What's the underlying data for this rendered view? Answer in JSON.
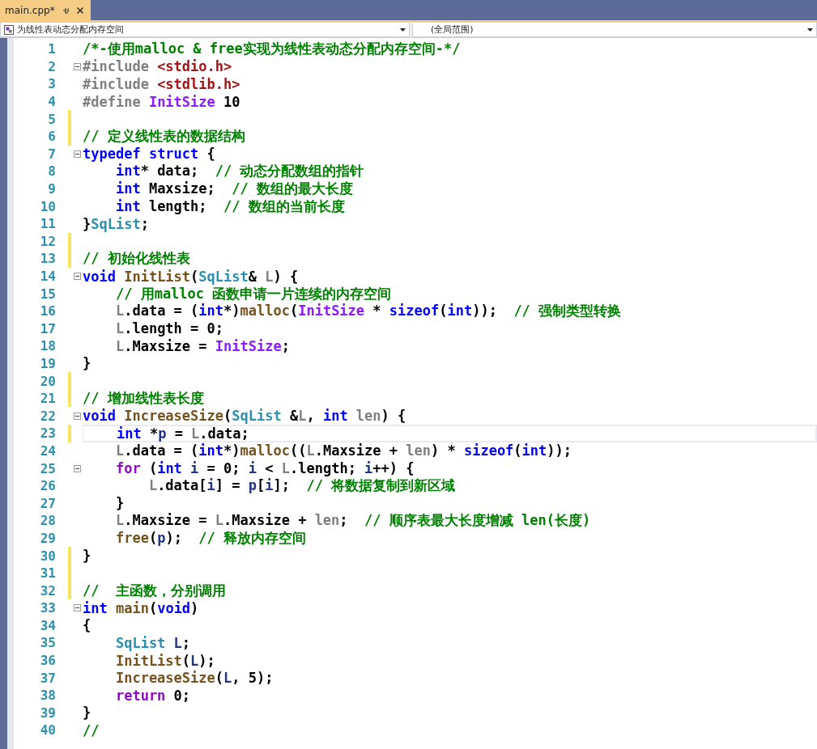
{
  "tabs": [
    {
      "label": "main.cpp*",
      "selected": true
    }
  ],
  "navigation": {
    "scope": "为线性表动态分配内存空间",
    "member": "(全局范围)"
  },
  "lines": [
    {
      "number": "1",
      "changed": false,
      "fold": false,
      "current": false,
      "tokens": [
        {
          "kind": "cm",
          "text": "/*-使用malloc & free实现为线性表动态分配内存空间-*/"
        }
      ]
    },
    {
      "number": "2",
      "changed": false,
      "fold": true,
      "current": false,
      "tokens": [
        {
          "kind": "pre",
          "text": "#include "
        },
        {
          "kind": "str",
          "text": "<stdio.h>"
        }
      ]
    },
    {
      "number": "3",
      "changed": false,
      "fold": false,
      "current": false,
      "tokens": [
        {
          "kind": "pre",
          "text": "#include "
        },
        {
          "kind": "str",
          "text": "<stdlib.h>"
        }
      ]
    },
    {
      "number": "4",
      "changed": false,
      "fold": false,
      "current": false,
      "tokens": [
        {
          "kind": "pre",
          "text": "#define "
        },
        {
          "kind": "mac",
          "text": "InitSize"
        },
        {
          "kind": "pl",
          "text": " 10"
        }
      ]
    },
    {
      "number": "5",
      "changed": true,
      "fold": false,
      "current": false
    },
    {
      "number": "6",
      "changed": true,
      "fold": false,
      "current": false,
      "tokens": [
        {
          "kind": "cm",
          "text": "// 定义线性表的数据结构"
        }
      ]
    },
    {
      "number": "7",
      "changed": false,
      "fold": true,
      "current": false,
      "tokens": [
        {
          "kind": "kw",
          "text": "typedef"
        },
        {
          "kind": "kw",
          "text": " struct"
        },
        {
          "kind": "pl",
          "text": " {"
        }
      ]
    },
    {
      "number": "8",
      "changed": false,
      "fold": false,
      "current": false,
      "tokens": [
        {
          "kind": "kw",
          "text": "    int"
        },
        {
          "kind": "pl",
          "text": "* data;  "
        },
        {
          "kind": "cm",
          "text": "// 动态分配数组的指针"
        }
      ]
    },
    {
      "number": "9",
      "changed": false,
      "fold": false,
      "current": false,
      "tokens": [
        {
          "kind": "kw",
          "text": "    int"
        },
        {
          "kind": "pl",
          "text": " Maxsize;  "
        },
        {
          "kind": "cm",
          "text": "// 数组的最大长度"
        }
      ]
    },
    {
      "number": "10",
      "changed": false,
      "fold": false,
      "current": false,
      "tokens": [
        {
          "kind": "kw",
          "text": "    int"
        },
        {
          "kind": "pl",
          "text": " length;  "
        },
        {
          "kind": "cm",
          "text": "// 数组的当前长度"
        }
      ]
    },
    {
      "number": "11",
      "changed": false,
      "fold": false,
      "current": false,
      "tokens": [
        {
          "kind": "pl",
          "text": "}"
        },
        {
          "kind": "typ",
          "text": "SqList"
        },
        {
          "kind": "pl",
          "text": ";"
        }
      ]
    },
    {
      "number": "12",
      "changed": true,
      "fold": false,
      "current": false
    },
    {
      "number": "13",
      "changed": true,
      "fold": false,
      "current": false,
      "tokens": [
        {
          "kind": "cm",
          "text": "// 初始化线性表"
        }
      ]
    },
    {
      "number": "14",
      "changed": false,
      "fold": true,
      "current": false,
      "tokens": [
        {
          "kind": "kw",
          "text": "void"
        },
        {
          "kind": "fn",
          "text": " InitList"
        },
        {
          "kind": "pl",
          "text": "("
        },
        {
          "kind": "typ",
          "text": "SqList"
        },
        {
          "kind": "pl",
          "text": "& "
        },
        {
          "kind": "prm",
          "text": "L"
        },
        {
          "kind": "pl",
          "text": ") {"
        }
      ]
    },
    {
      "number": "15",
      "changed": false,
      "fold": false,
      "current": false,
      "tokens": [
        {
          "kind": "cm",
          "text": "    // 用malloc 函数申请一片连续的内存空间"
        }
      ]
    },
    {
      "number": "16",
      "changed": false,
      "fold": false,
      "current": false,
      "tokens": [
        {
          "kind": "prm",
          "text": "    L"
        },
        {
          "kind": "pl",
          "text": ".data = ("
        },
        {
          "kind": "kw",
          "text": "int"
        },
        {
          "kind": "pl",
          "text": "*)"
        },
        {
          "kind": "fn",
          "text": "malloc"
        },
        {
          "kind": "pl",
          "text": "("
        },
        {
          "kind": "mac",
          "text": "InitSize"
        },
        {
          "kind": "pl",
          "text": " * "
        },
        {
          "kind": "kw",
          "text": "sizeof"
        },
        {
          "kind": "pl",
          "text": "("
        },
        {
          "kind": "kw",
          "text": "int"
        },
        {
          "kind": "pl",
          "text": "));  "
        },
        {
          "kind": "cm",
          "text": "// 强制类型转换"
        }
      ]
    },
    {
      "number": "17",
      "changed": false,
      "fold": false,
      "current": false,
      "tokens": [
        {
          "kind": "prm",
          "text": "    L"
        },
        {
          "kind": "pl",
          "text": ".length = 0;"
        }
      ]
    },
    {
      "number": "18",
      "changed": false,
      "fold": false,
      "current": false,
      "tokens": [
        {
          "kind": "prm",
          "text": "    L"
        },
        {
          "kind": "pl",
          "text": ".Maxsize = "
        },
        {
          "kind": "mac",
          "text": "InitSize"
        },
        {
          "kind": "pl",
          "text": ";"
        }
      ]
    },
    {
      "number": "19",
      "changed": false,
      "fold": false,
      "current": false,
      "tokens": [
        {
          "kind": "pl",
          "text": "}"
        }
      ]
    },
    {
      "number": "20",
      "changed": true,
      "fold": false,
      "current": false
    },
    {
      "number": "21",
      "changed": true,
      "fold": false,
      "current": false,
      "tokens": [
        {
          "kind": "cm",
          "text": "// 增加线性表长度"
        }
      ]
    },
    {
      "number": "22",
      "changed": false,
      "fold": true,
      "current": false,
      "tokens": [
        {
          "kind": "kw",
          "text": "void"
        },
        {
          "kind": "fn",
          "text": " IncreaseSize"
        },
        {
          "kind": "pl",
          "text": "("
        },
        {
          "kind": "typ",
          "text": "SqList"
        },
        {
          "kind": "pl",
          "text": " &"
        },
        {
          "kind": "prm",
          "text": "L"
        },
        {
          "kind": "pl",
          "text": ", "
        },
        {
          "kind": "kw",
          "text": "int"
        },
        {
          "kind": "prm",
          "text": " len"
        },
        {
          "kind": "pl",
          "text": ") {"
        }
      ]
    },
    {
      "number": "23",
      "changed": true,
      "fold": false,
      "current": true,
      "tokens": [
        {
          "kind": "kw",
          "text": "    int"
        },
        {
          "kind": "pl",
          "text": " *"
        },
        {
          "kind": "var",
          "text": "p"
        },
        {
          "kind": "pl",
          "text": " = "
        },
        {
          "kind": "prm",
          "text": "L"
        },
        {
          "kind": "pl",
          "text": ".data;"
        }
      ]
    },
    {
      "number": "24",
      "changed": false,
      "fold": false,
      "current": false,
      "tokens": [
        {
          "kind": "prm",
          "text": "    L"
        },
        {
          "kind": "pl",
          "text": ".data = ("
        },
        {
          "kind": "kw",
          "text": "int"
        },
        {
          "kind": "pl",
          "text": "*)"
        },
        {
          "kind": "fn",
          "text": "malloc"
        },
        {
          "kind": "pl",
          "text": "(("
        },
        {
          "kind": "prm",
          "text": "L"
        },
        {
          "kind": "pl",
          "text": ".Maxsize + "
        },
        {
          "kind": "prm",
          "text": "len"
        },
        {
          "kind": "pl",
          "text": ") * "
        },
        {
          "kind": "kw",
          "text": "sizeof"
        },
        {
          "kind": "pl",
          "text": "("
        },
        {
          "kind": "kw",
          "text": "int"
        },
        {
          "kind": "pl",
          "text": "));"
        }
      ]
    },
    {
      "number": "25",
      "changed": false,
      "fold": true,
      "current": false,
      "tokens": [
        {
          "kind": "ctl",
          "text": "    for"
        },
        {
          "kind": "pl",
          "text": " ("
        },
        {
          "kind": "kw",
          "text": "int"
        },
        {
          "kind": "var",
          "text": " i"
        },
        {
          "kind": "pl",
          "text": " = 0; "
        },
        {
          "kind": "var",
          "text": "i"
        },
        {
          "kind": "pl",
          "text": " < "
        },
        {
          "kind": "prm",
          "text": "L"
        },
        {
          "kind": "pl",
          "text": ".length; "
        },
        {
          "kind": "var",
          "text": "i"
        },
        {
          "kind": "pl",
          "text": "++) {"
        }
      ]
    },
    {
      "number": "26",
      "changed": false,
      "fold": false,
      "current": false,
      "tokens": [
        {
          "kind": "prm",
          "text": "        L"
        },
        {
          "kind": "pl",
          "text": ".data["
        },
        {
          "kind": "var",
          "text": "i"
        },
        {
          "kind": "pl",
          "text": "] = "
        },
        {
          "kind": "var",
          "text": "p"
        },
        {
          "kind": "pl",
          "text": "["
        },
        {
          "kind": "var",
          "text": "i"
        },
        {
          "kind": "pl",
          "text": "];  "
        },
        {
          "kind": "cm",
          "text": "// 将数据复制到新区域"
        }
      ]
    },
    {
      "number": "27",
      "changed": false,
      "fold": false,
      "current": false,
      "tokens": [
        {
          "kind": "pl",
          "text": "    }"
        }
      ]
    },
    {
      "number": "28",
      "changed": false,
      "fold": false,
      "current": false,
      "tokens": [
        {
          "kind": "prm",
          "text": "    L"
        },
        {
          "kind": "pl",
          "text": ".Maxsize = "
        },
        {
          "kind": "prm",
          "text": "L"
        },
        {
          "kind": "pl",
          "text": ".Maxsize + "
        },
        {
          "kind": "prm",
          "text": "len"
        },
        {
          "kind": "pl",
          "text": ";  "
        },
        {
          "kind": "cm",
          "text": "// 顺序表最大长度增减 len(长度)"
        }
      ]
    },
    {
      "number": "29",
      "changed": false,
      "fold": false,
      "current": false,
      "tokens": [
        {
          "kind": "fn",
          "text": "    free"
        },
        {
          "kind": "pl",
          "text": "("
        },
        {
          "kind": "var",
          "text": "p"
        },
        {
          "kind": "pl",
          "text": ");  "
        },
        {
          "kind": "cm",
          "text": "// 释放内存空间"
        }
      ]
    },
    {
      "number": "30",
      "changed": true,
      "fold": false,
      "current": false,
      "tokens": [
        {
          "kind": "pl",
          "text": "}"
        }
      ]
    },
    {
      "number": "31",
      "changed": true,
      "fold": false,
      "current": false
    },
    {
      "number": "32",
      "changed": true,
      "fold": false,
      "current": false,
      "tokens": [
        {
          "kind": "cm",
          "text": "//  主函数，分别调用"
        }
      ]
    },
    {
      "number": "33",
      "changed": false,
      "fold": true,
      "current": false,
      "tokens": [
        {
          "kind": "kw",
          "text": "int"
        },
        {
          "kind": "fn",
          "text": " main"
        },
        {
          "kind": "pl",
          "text": "("
        },
        {
          "kind": "kw",
          "text": "void"
        },
        {
          "kind": "pl",
          "text": ")"
        }
      ]
    },
    {
      "number": "34",
      "changed": false,
      "fold": false,
      "current": false,
      "tokens": [
        {
          "kind": "pl",
          "text": "{"
        }
      ]
    },
    {
      "number": "35",
      "changed": false,
      "fold": false,
      "current": false,
      "tokens": [
        {
          "kind": "typ",
          "text": "    SqList"
        },
        {
          "kind": "var",
          "text": " L"
        },
        {
          "kind": "pl",
          "text": ";"
        }
      ]
    },
    {
      "number": "36",
      "changed": false,
      "fold": false,
      "current": false,
      "tokens": [
        {
          "kind": "fn",
          "text": "    InitList"
        },
        {
          "kind": "pl",
          "text": "("
        },
        {
          "kind": "var",
          "text": "L"
        },
        {
          "kind": "pl",
          "text": ");"
        }
      ]
    },
    {
      "number": "37",
      "changed": false,
      "fold": false,
      "current": false,
      "tokens": [
        {
          "kind": "fn",
          "text": "    IncreaseSize"
        },
        {
          "kind": "pl",
          "text": "("
        },
        {
          "kind": "var",
          "text": "L"
        },
        {
          "kind": "pl",
          "text": ", 5);"
        }
      ]
    },
    {
      "number": "38",
      "changed": false,
      "fold": false,
      "current": false,
      "tokens": [
        {
          "kind": "ctl",
          "text": "    return"
        },
        {
          "kind": "pl",
          "text": " 0;"
        }
      ]
    },
    {
      "number": "39",
      "changed": false,
      "fold": false,
      "current": false,
      "tokens": [
        {
          "kind": "pl",
          "text": "}"
        }
      ]
    },
    {
      "number": "40",
      "changed": false,
      "fold": false,
      "current": false,
      "tokens": [
        {
          "kind": "cm",
          "text": "//"
        }
      ]
    }
  ]
}
